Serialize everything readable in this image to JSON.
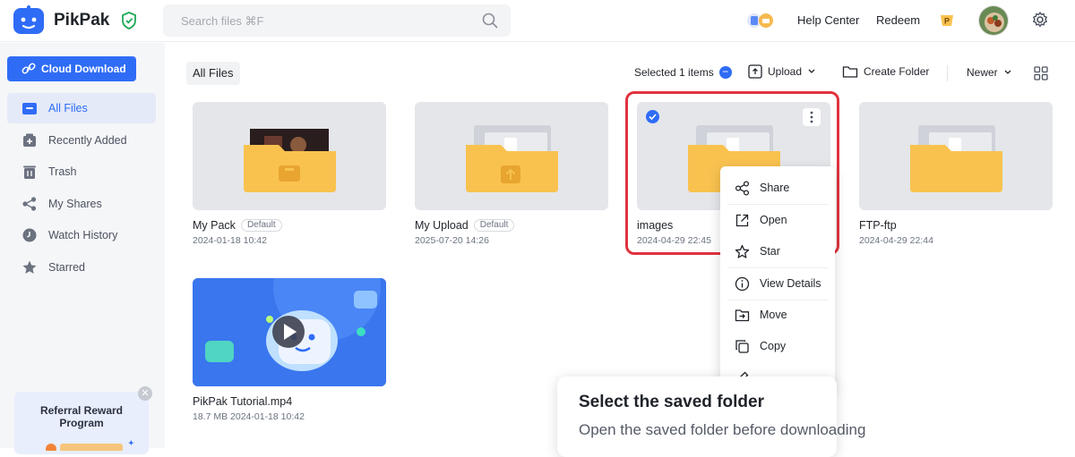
{
  "header": {
    "brand": "PikPak",
    "search_placeholder": "Search files ⌘F",
    "help_center": "Help Center",
    "redeem": "Redeem"
  },
  "sidebar": {
    "cloud_download": "Cloud Download",
    "items": [
      {
        "label": "All Files",
        "icon": "folder-icon"
      },
      {
        "label": "Recently Added",
        "icon": "recent-icon"
      },
      {
        "label": "Trash",
        "icon": "trash-icon"
      },
      {
        "label": "My Shares",
        "icon": "share-icon"
      },
      {
        "label": "Watch History",
        "icon": "clock-icon"
      },
      {
        "label": "Starred",
        "icon": "star-icon"
      }
    ],
    "referral": "Referral Reward Program"
  },
  "toolbar": {
    "breadcrumb": "All Files",
    "selected": "Selected 1 items",
    "upload": "Upload",
    "create_folder": "Create Folder",
    "sort": "Newer"
  },
  "files": [
    {
      "name": "My Pack",
      "tag": "Default",
      "meta": "2024-01-18 10:42"
    },
    {
      "name": "My Upload",
      "tag": "Default",
      "meta": "2025-07-20 14:26"
    },
    {
      "name": "images",
      "meta": "2024-04-29 22:45"
    },
    {
      "name": "FTP-ftp",
      "meta": "2024-04-29 22:44"
    },
    {
      "name": "PikPak Tutorial.mp4",
      "meta": "18.7 MB  2024-01-18 10:42"
    }
  ],
  "context_menu": [
    "Share",
    "Open",
    "Star",
    "View Details",
    "Move",
    "Copy"
  ],
  "tooltip": {
    "title": "Select the saved folder",
    "body": "Open the saved folder before downloading"
  },
  "colors": {
    "accent": "#2f6cf6",
    "folder": "#f9c24f",
    "highlight": "#e0333f"
  }
}
